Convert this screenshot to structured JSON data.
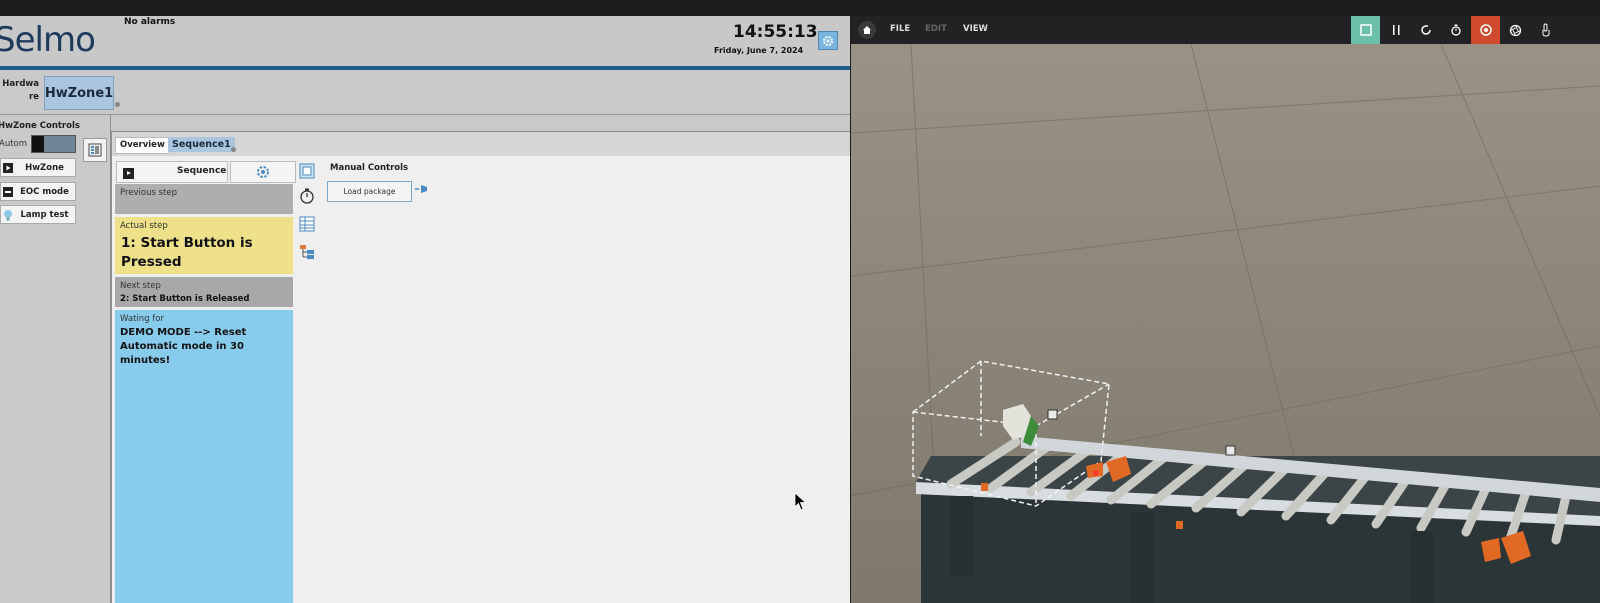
{
  "app": {
    "logo": "Selmo",
    "alarms": "No alarms",
    "time": "14:55:13",
    "date": "Friday, June 7, 2024"
  },
  "hardware": {
    "label": "Hardware",
    "zone_tab": "HwZone1"
  },
  "controls": {
    "title": "HwZone Controls",
    "mode_label": "Autom",
    "buttons": [
      {
        "label": "HwZone",
        "icon": "play-icon"
      },
      {
        "label": "EOC mode",
        "icon": "minus-icon"
      },
      {
        "label": "Lamp test",
        "icon": "bulb-icon"
      }
    ]
  },
  "tabs": {
    "overview": "Overview",
    "sequence": "Sequence1"
  },
  "sequence": {
    "button_label": "Sequence",
    "previous_caption": "Previous step",
    "actual_caption": "Actual step",
    "actual_value": "1: Start Button is Pressed",
    "next_caption": "Next step",
    "next_value": "2: Start Button is Released",
    "waiting_caption": "Wating for",
    "waiting_value": "DEMO MODE --> Reset Automatic mode in 30 minutes!"
  },
  "manual": {
    "title": "Manual Controls",
    "load_button": "Load package"
  },
  "viewer": {
    "menu": {
      "file": "FILE",
      "edit": "EDIT",
      "view": "VIEW"
    },
    "colors": {
      "active": "#6cbfa8",
      "record": "#d04a2e"
    }
  }
}
